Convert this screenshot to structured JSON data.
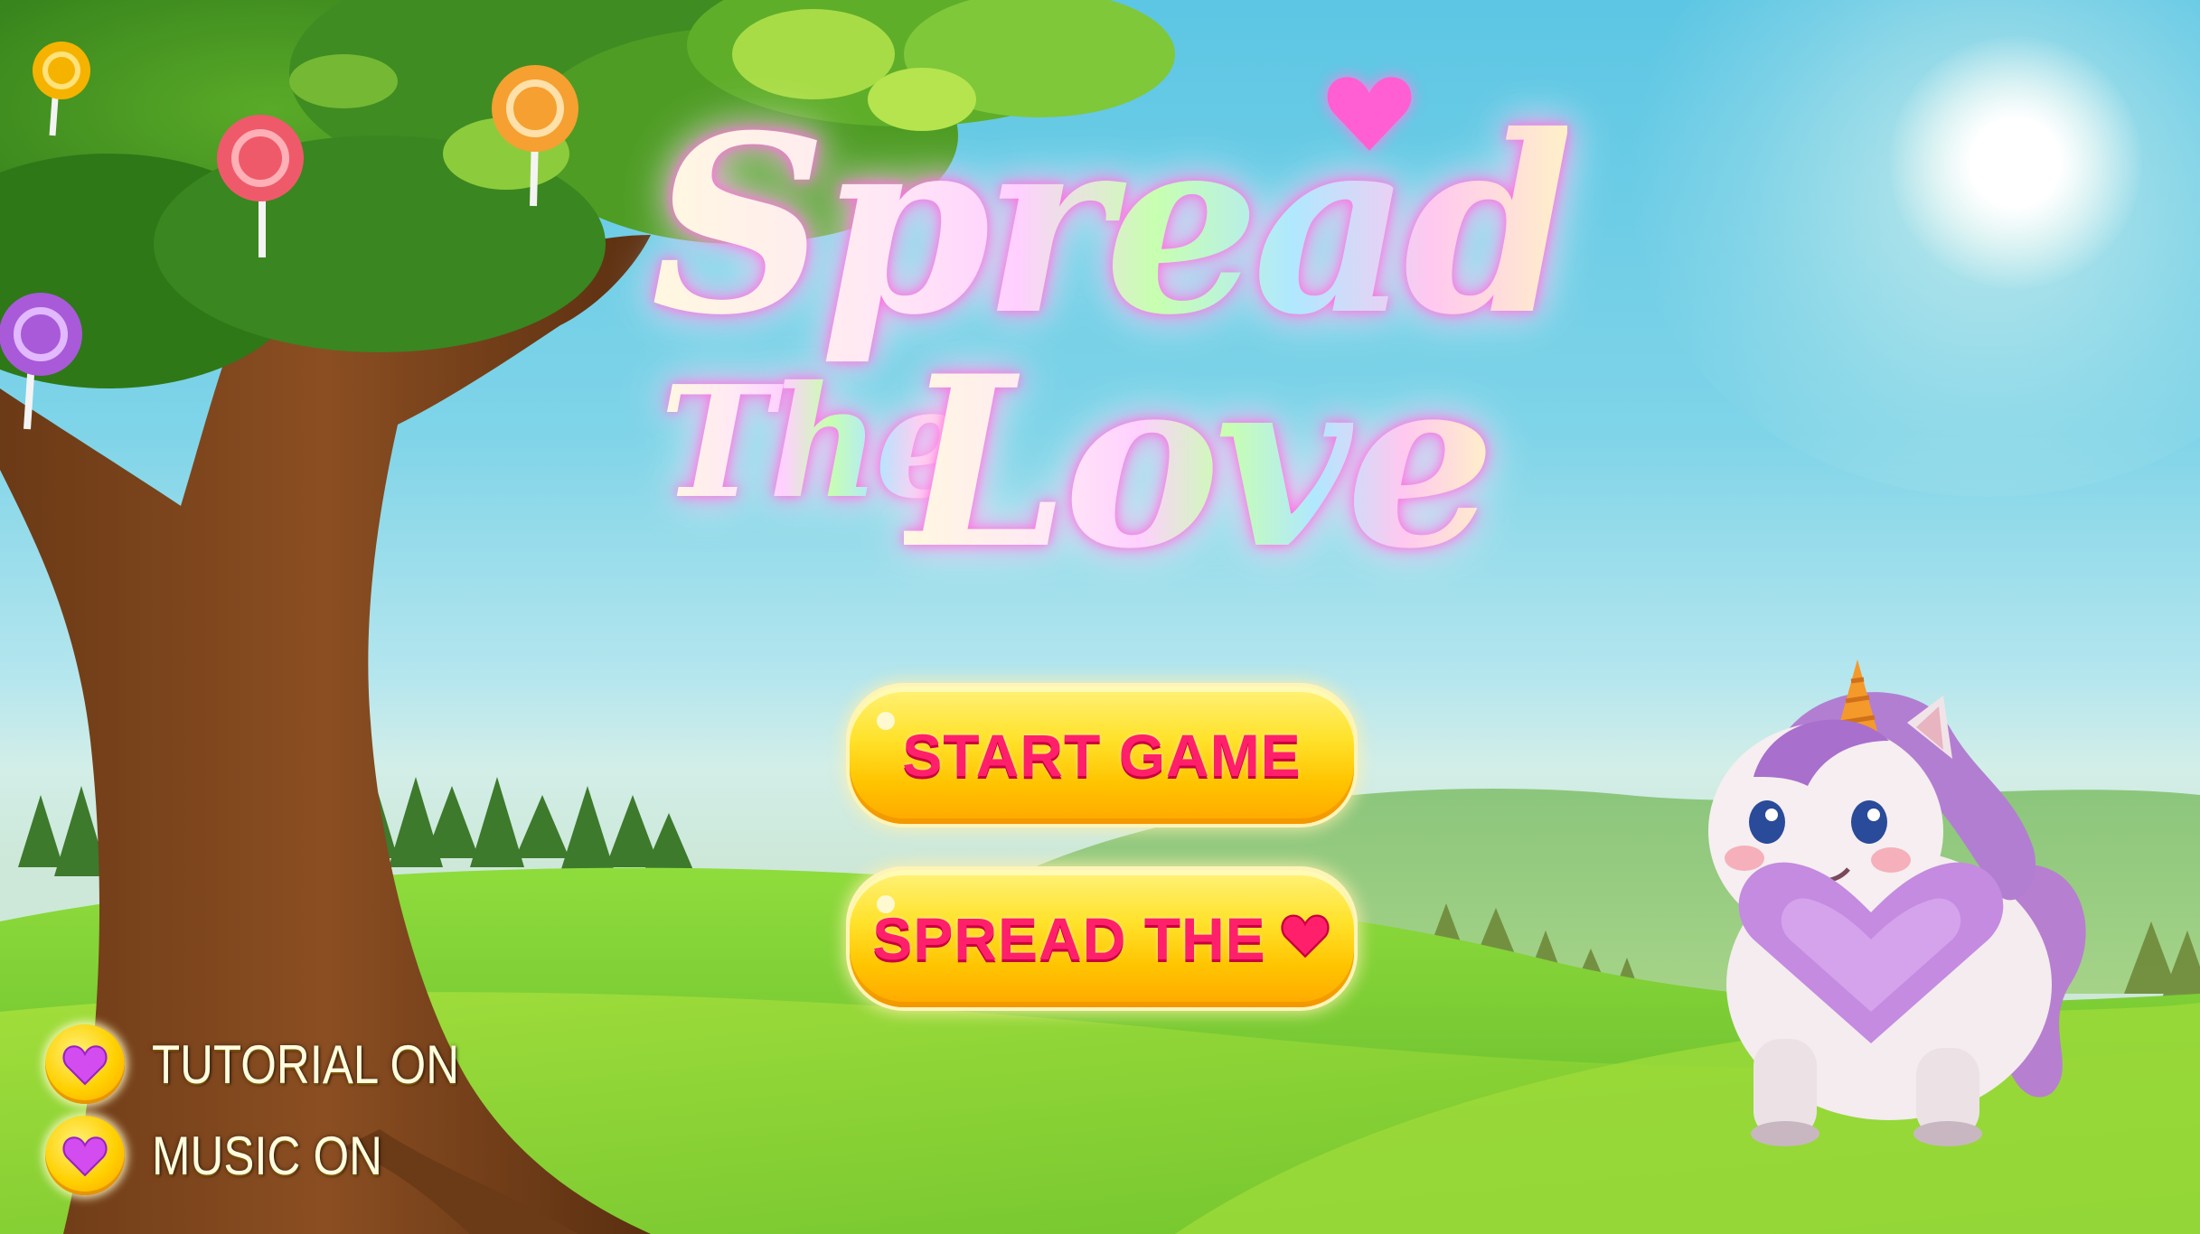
{
  "game": {
    "title_line1": "Spread",
    "title_line2": "The",
    "title_line3": "Love"
  },
  "menu": {
    "start_label": "START GAME",
    "spread_label": "SPREAD THE",
    "spread_icon": "heart-icon"
  },
  "settings": {
    "tutorial_label": "TUTORIAL ON",
    "music_label": "MUSIC ON",
    "toggle_icon": "heart-icon"
  },
  "colors": {
    "button_fill": "#ffd400",
    "button_text": "#ff1f6a",
    "toggle_heart": "#d24cf0",
    "sky": "#5cc6e4",
    "grass": "#7fd53a"
  }
}
